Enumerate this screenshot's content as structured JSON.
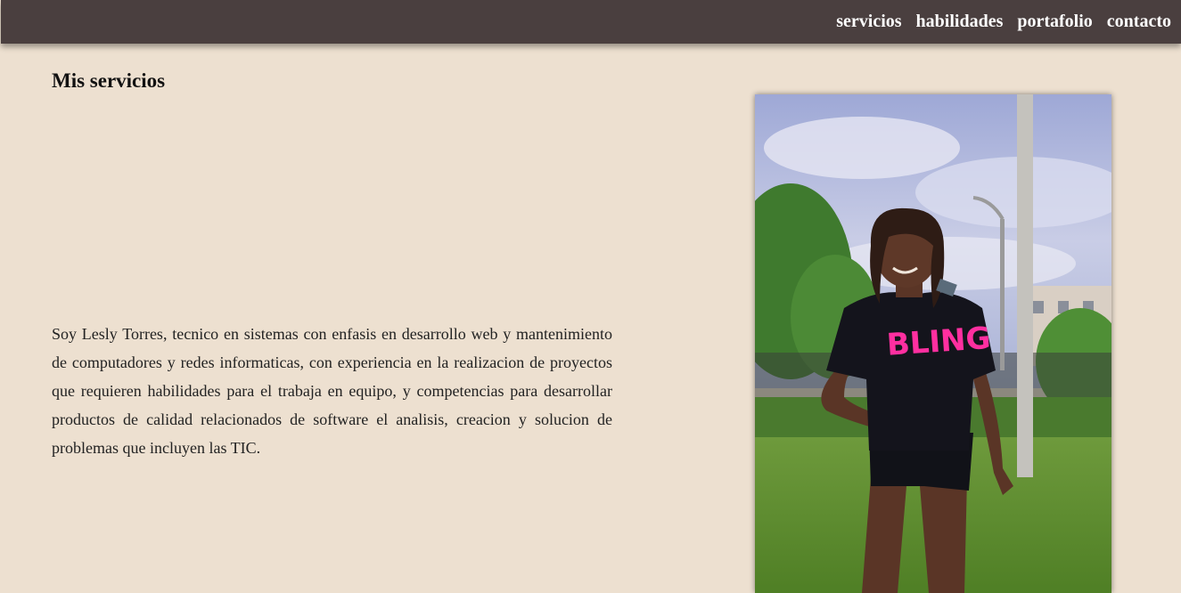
{
  "nav": {
    "items": [
      {
        "label": "servicios"
      },
      {
        "label": "habilidades"
      },
      {
        "label": "portafolio"
      },
      {
        "label": "contacto"
      }
    ]
  },
  "main": {
    "title": "Mis servicios",
    "paragraph": "Soy Lesly Torres, tecnico en sistemas con enfasis en desarrollo web y mantenimiento de computadores y redes informaticas, con experiencia en la realizacion de proyectos que requieren habilidades para el trabaja en equipo, y competencias para desarrollar productos de calidad relacionados de software el analisis, creacion y solucion de problemas que incluyen las TIC.",
    "photo": {
      "shirt_text": "BLING"
    }
  },
  "colors": {
    "navbar_bg": "#4a3f3f",
    "page_bg": "#ede0d0",
    "nav_text": "#ffffff",
    "shirt_print": "#ff2fa0"
  }
}
